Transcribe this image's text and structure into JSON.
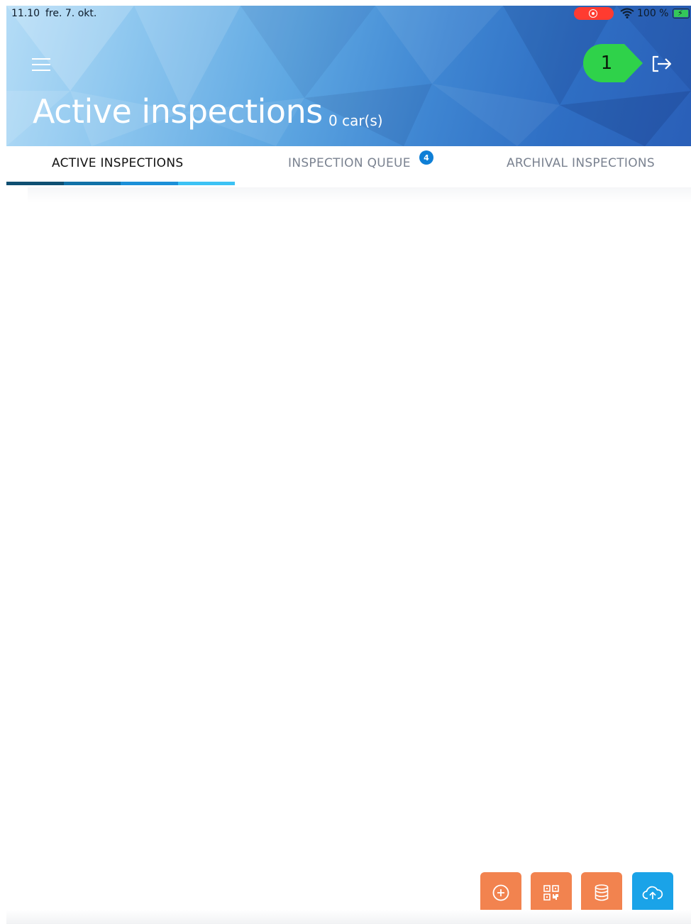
{
  "status_bar": {
    "time": "11.10",
    "date": "fre. 7. okt.",
    "battery_text": "100 %"
  },
  "header": {
    "title": "Active inspections",
    "subtitle": "0 car(s)",
    "marker_number": "1",
    "marker_color": "#2fd24a"
  },
  "tabs": {
    "active_inspections": "ACTIVE INSPECTIONS",
    "inspection_queue": "INSPECTION QUEUE",
    "inspection_queue_badge": "4",
    "archival_inspections": "ARCHIVAL INSPECTIONS"
  },
  "fab_buttons": [
    {
      "icon": "plus-circle-icon",
      "color": "#f2834f"
    },
    {
      "icon": "qr-code-icon",
      "color": "#f2834f"
    },
    {
      "icon": "database-icon",
      "color": "#f2834f"
    },
    {
      "icon": "cloud-upload-icon",
      "color": "#1aa3e8"
    }
  ],
  "colors": {
    "accent_orange": "#f2834f",
    "accent_blue": "#1aa3e8",
    "tab_underline": [
      "#0f4f72",
      "#1272a8",
      "#1c90d8",
      "#3cc2f4"
    ]
  }
}
